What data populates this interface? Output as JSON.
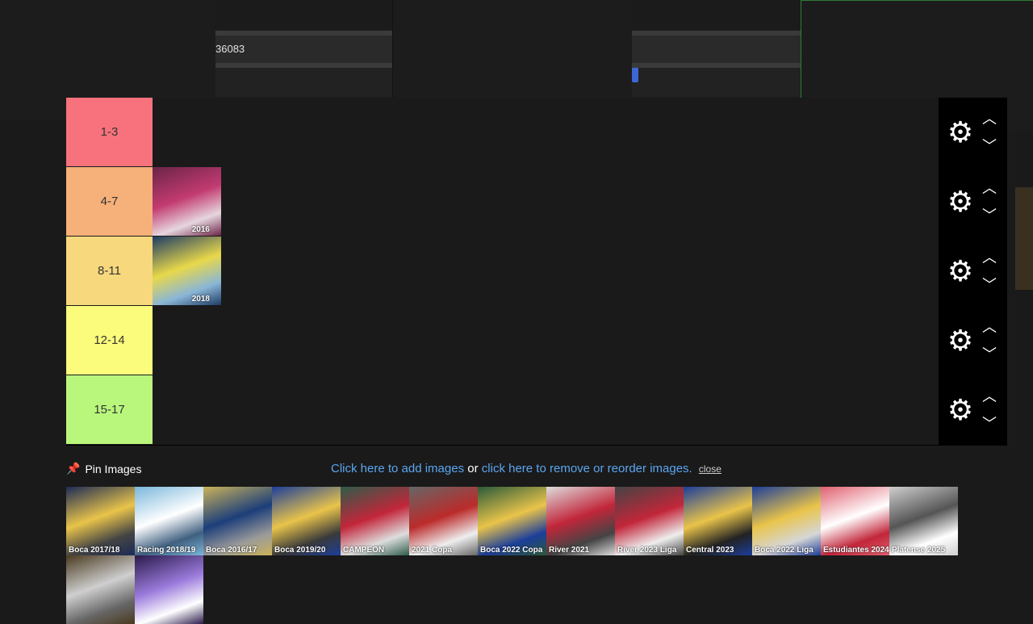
{
  "overlay": {
    "field_text": "36083"
  },
  "tiers": [
    {
      "label": "1-3",
      "color": "#f7727c",
      "items": []
    },
    {
      "label": "4-7",
      "color": "#f6b07a",
      "items": [
        {
          "label": "2016",
          "palette": [
            "#6b2446",
            "#c23b71",
            "#e6d6de"
          ]
        }
      ]
    },
    {
      "label": "8-11",
      "color": "#f7d87c",
      "items": [
        {
          "label": "2018",
          "palette": [
            "#1d3b66",
            "#e8d84a",
            "#8ab6d6"
          ]
        }
      ]
    },
    {
      "label": "12-14",
      "color": "#fbfb7c",
      "items": []
    },
    {
      "label": "15-17",
      "color": "#b9f77c",
      "items": []
    }
  ],
  "controls": {
    "settings_icon": "gear-icon",
    "move_up_icon": "chevron-up-icon",
    "move_down_icon": "chevron-down-icon"
  },
  "pin": {
    "icon": "pin-icon",
    "label": "Pin Images"
  },
  "help": {
    "add_link": "Click here to add images",
    "or_text": " or ",
    "reorder_link": "click here to remove or reorder images.",
    "close_label": "close"
  },
  "pool": [
    {
      "label": "Boca 2017/18",
      "palette": [
        "#1d2b55",
        "#e9c44a",
        "#444"
      ]
    },
    {
      "label": "Racing 2018/19",
      "palette": [
        "#7ab7db",
        "#ffffff",
        "#406080"
      ]
    },
    {
      "label": "Boca 2016/17",
      "palette": [
        "#cbb35a",
        "#1c3e7a",
        "#9a9a9a"
      ]
    },
    {
      "label": "Boca 2019/20",
      "palette": [
        "#1c3e9a",
        "#e9c44a",
        "#3a3a3a"
      ]
    },
    {
      "label": "CAMPEON",
      "palette": [
        "#2e5c4a",
        "#c2263a",
        "#dddddd"
      ]
    },
    {
      "label": "2021 Copa",
      "palette": [
        "#666666",
        "#bb2b2b",
        "#eeeeee"
      ]
    },
    {
      "label": "Boca 2022 Copa",
      "palette": [
        "#2a5a3a",
        "#e9c44a",
        "#1c3e9a"
      ]
    },
    {
      "label": "River 2021",
      "palette": [
        "#dddddd",
        "#c2263a",
        "#444444"
      ]
    },
    {
      "label": "River 2023 Liga",
      "palette": [
        "#444444",
        "#c2263a",
        "#eeeeee"
      ]
    },
    {
      "label": "Central 2023",
      "palette": [
        "#1c3e9a",
        "#e9c44a",
        "#222222"
      ]
    },
    {
      "label": "Boca 2022 Liga",
      "palette": [
        "#1c3e9a",
        "#e9c44a",
        "#d6d6d6"
      ]
    },
    {
      "label": "Estudiantes 2024 Copa",
      "palette": [
        "#e06070",
        "#ffffff",
        "#c2263a"
      ]
    },
    {
      "label": "Platense 2025",
      "palette": [
        "#cfcfcf",
        "#555555",
        "#ffffff"
      ]
    },
    {
      "label": "",
      "palette": [
        "#4a3a20",
        "#cfcfcf",
        "#666666"
      ]
    },
    {
      "label": "",
      "palette": [
        "#2a1a4a",
        "#9a7adb",
        "#ffffff"
      ]
    }
  ]
}
